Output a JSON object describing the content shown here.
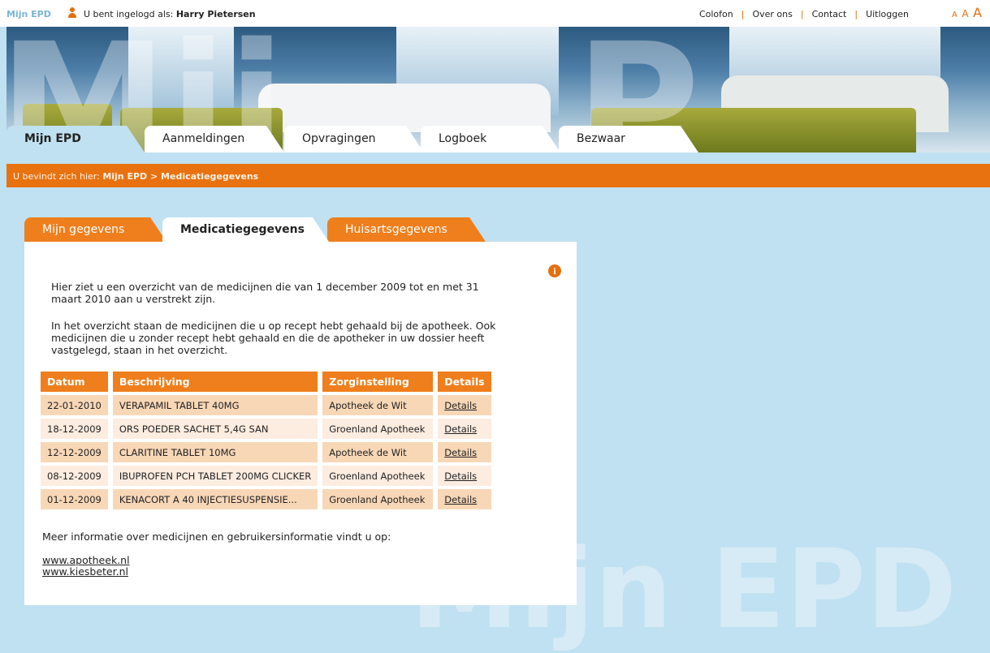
{
  "topbar": {
    "brand": "Mijn EPD",
    "logged_in_label": "U bent ingelogd als:",
    "user_name": "Harry Pietersen",
    "links": [
      "Colofon",
      "Over ons",
      "Contact",
      "Uitloggen"
    ],
    "font_sizes": [
      "A",
      "A",
      "A"
    ]
  },
  "nav": {
    "tabs": [
      "Mijn EPD",
      "Aanmeldingen",
      "Opvragingen",
      "Logboek",
      "Bezwaar"
    ],
    "active": "Mijn EPD"
  },
  "breadcrumb": {
    "label": "U bevindt zich hier:",
    "path": "Mijn EPD > Medicatiegegevens"
  },
  "content_tabs": [
    "Mijn gegevens",
    "Medicatiegegevens",
    "Huisartsgegevens"
  ],
  "intro": {
    "p1": "Hier ziet u een overzicht van de medicijnen die van 1 december 2009 tot en met 31 maart  2010 aan u verstrekt zijn.",
    "p2": "In het overzicht staan de medicijnen die u op recept hebt gehaald bij de apotheek. Ook medicijnen die u zonder recept hebt gehaald en die de apotheker in uw dossier heeft vastgelegd, staan in het overzicht."
  },
  "table": {
    "headers": [
      "Datum",
      "Beschrijving",
      "Zorginstelling",
      "Details"
    ],
    "rows": [
      {
        "datum": "22-01-2010",
        "beschrijving": "VERAPAMIL TABLET 40MG",
        "zorginstelling": "Apotheek de Wit",
        "details": "Details"
      },
      {
        "datum": "18-12-2009",
        "beschrijving": "ORS POEDER SACHET 5,4G SAN",
        "zorginstelling": "Groenland Apotheek",
        "details": "Details"
      },
      {
        "datum": "12-12-2009",
        "beschrijving": "CLARITINE TABLET 10MG",
        "zorginstelling": "Apotheek de Wit",
        "details": "Details"
      },
      {
        "datum": "08-12-2009",
        "beschrijving": "IBUPROFEN PCH TABLET 200MG CLICKER",
        "zorginstelling": "Groenland Apotheek",
        "details": "Details"
      },
      {
        "datum": "01-12-2009",
        "beschrijving": "KENACORT A 40 INJECTIESUSPENSIE...",
        "zorginstelling": "Groenland Apotheek",
        "details": "Details"
      }
    ]
  },
  "more_info": "Meer informatie over medicijnen en gebruikersinformatie vindt u op:",
  "links": [
    "www.apotheek.nl",
    "www.kiesbeter.nl"
  ],
  "watermark": "Mijn EPD",
  "colors": {
    "orange": "#e8720f",
    "background": "#c0e1f1"
  }
}
